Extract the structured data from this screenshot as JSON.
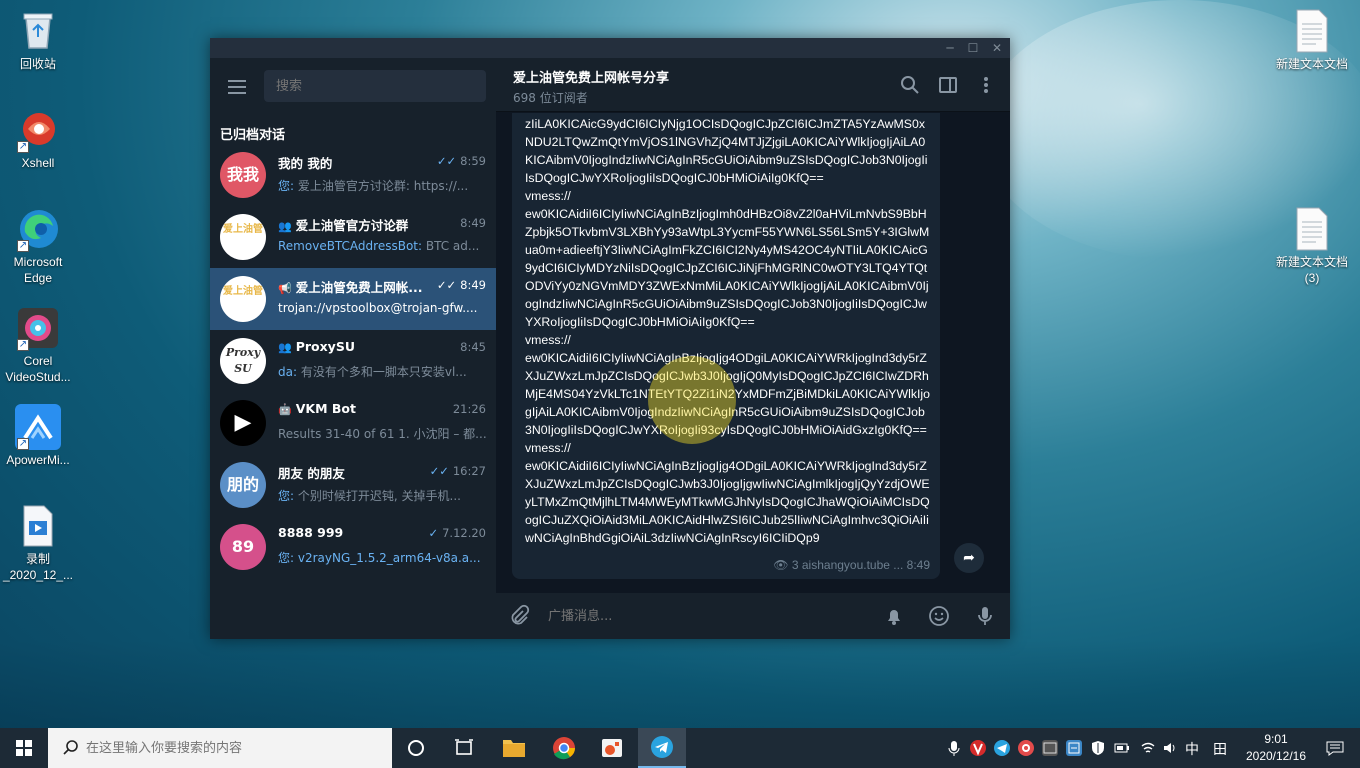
{
  "desktop": {
    "icons": [
      {
        "label": "回收站",
        "name": "recycle-bin"
      },
      {
        "label": "Xshell",
        "name": "xshell"
      },
      {
        "label": "Microsoft Edge",
        "name": "microsoft-edge"
      },
      {
        "label": "Corel VideoStud...",
        "name": "corel-videostudio"
      },
      {
        "label": "ApowerMi...",
        "name": "apowermirror"
      },
      {
        "label": "录制 _2020_12_...",
        "name": "recording-file"
      },
      {
        "label": "新建文本文档",
        "name": "new-text-doc"
      },
      {
        "label": "新建文本文档 (3)",
        "name": "new-text-doc-3"
      }
    ]
  },
  "window": {
    "search_placeholder": "搜索",
    "archived_title": "已归档对话",
    "chats": [
      {
        "name": "我的 我的",
        "time": "8:59",
        "sender": "您:",
        "preview": "爱上油管官方讨论群: https://...",
        "avatar_text": "我我",
        "avatar_color": "#e05766",
        "read": true
      },
      {
        "name": "爱上油管官方讨论群",
        "time": "8:49",
        "sender": "RemoveBTCAddressBot:",
        "preview": "BTC ad...",
        "avatar_text": "爱上油管",
        "avatar_color": "#ffffff",
        "group": true
      },
      {
        "name": "爱上油管免费上网帐...",
        "time": "8:49",
        "sender": "",
        "preview": "trojan://vpstoolbox@trojan-gfw....",
        "avatar_text": "爱上油管",
        "avatar_color": "#ffffff",
        "channel": true,
        "read": true,
        "active": true
      },
      {
        "name": "ProxySU",
        "time": "8:45",
        "sender": "da:",
        "preview": "有没有个多和一脚本只安装vl...",
        "avatar_text": "Proxy SU",
        "avatar_color": "#ffffff",
        "group": true
      },
      {
        "name": "VKM Bot",
        "time": "21:26",
        "sender": "",
        "preview": "Results 31-40 of 61  1. 小沈阳 – 都...",
        "avatar_text": "▶",
        "avatar_color": "#000000",
        "bot": true
      },
      {
        "name": "朋友 的朋友",
        "time": "16:27",
        "sender": "您:",
        "preview": "个别时候打开迟钝, 关掉手机...",
        "avatar_text": "朋的",
        "avatar_color": "#5b8fc7",
        "read": true
      },
      {
        "name": "8888 999",
        "time": "7.12.20",
        "sender": "您:",
        "preview": "v2rayNG_1.5.2_arm64-v8a.a...",
        "avatar_text": "89",
        "avatar_color": "#d5508b",
        "sent": true
      }
    ],
    "channel_title": "爱上油管免费上网帐号分享",
    "subscribers": "698 位订阅者",
    "message_text": "zIiLA0KICAicG9ydCI6ICIyNjg1OCIsDQogICJpZCI6ICJmZTA5YzAwMS0xNDU2LTQwZmQtYmVjOS1lNGVhZjQ4MTJjZjgiLA0KICAiYWlkIjogIjAiLA0KICAibmV0IjogIndzIiwNCiAgInR5cGUiOiAibm9uZSIsDQogICJob3N0IjogIiIsDQogICJwYXRoIjogIiIsDQogICJ0bHMiOiAiIg0KfQ==\nvmess://\new0KICAidiI6ICIyIiwNCiAgInBzIjogImh0dHBzOi8vZ2l0aHViLmNvbS9BbHZpbjk5OTkvbmV3LXBhYy93aWtpL3YycmF55YWN6LS56LSm5Y+3IGlwMua0m+adieeftjY3IiwNCiAgImFkZCI6ICI2Ny4yMS42OC4yNTIiLA0KICAicG9ydCI6ICIyMDYzNiIsDQogICJpZCI6ICJiNjFhMGRlNC0wOTY3LTQ4YTQtODViYy0zNGVmMDY3ZWExNmMiLA0KICAiYWlkIjogIjAiLA0KICAibmV0IjogIndzIiwNCiAgInR5cGUiOiAibm9uZSIsDQogICJob3N0IjogIiIsDQogICJwYXRoIjogIiIsDQogICJ0bHMiOiAiIg0KfQ==\nvmess://\new0KICAidiI6ICIyIiwNCiAgInBzIjogIjg4ODgiLA0KICAiYWRkIjogInd3dy5rZXJuZWxzLmJpZCIsDQogICJwb3J0IjogIjQ0MyIsDQogICJpZCI6ICIwZDRhMjE4MS04YzVkLTc1NTEtYTQ2Zi1iN2YxMDFmZjBiMDkiLA0KICAiYWlkIjogIjAiLA0KICAibmV0IjogIndzIiwNCiAgInR5cGUiOiAibm9uZSIsDQogICJob3N0IjogIiIsDQogICJwYXRoIjogIi93cyIsDQogICJ0bHMiOiAidGxzIg0KfQ==\nvmess://\new0KICAidiI6ICIyIiwNCiAgInBzIjogIjg4ODgiLA0KICAiYWRkIjogInd3dy5rZXJuZWxzLmJpZCIsDQogICJwb3J0IjogIjgwIiwNCiAgImlkIjogIjQyYzdjOWEyLTMxZmQtMjlhLTM4MWEyMTkwMGJhNyIsDQogICJhaWQiOiAiMCIsDQogICJuZXQiOiAid3MiLA0KICAidHlwZSI6ICJub25lIiwNCiAgImhvc3QiOiAiIiwNCiAgInBhdGgiOiAiL3dzIiwNCiAgInRscyI6ICIiDQp9",
    "views": "3",
    "author": "aishangyou.tube ...",
    "message_time": "8:49",
    "input_placeholder": "广播消息..."
  },
  "taskbar": {
    "search_placeholder": "在这里输入你要搜索的内容",
    "ime": "中",
    "ime2": "田",
    "time": "9:01",
    "date": "2020/12/16"
  },
  "colors": {
    "accent": "#6ab2f2",
    "active_chat": "#2b5278",
    "panel": "#17212b",
    "chat_bg": "#0e1621"
  }
}
